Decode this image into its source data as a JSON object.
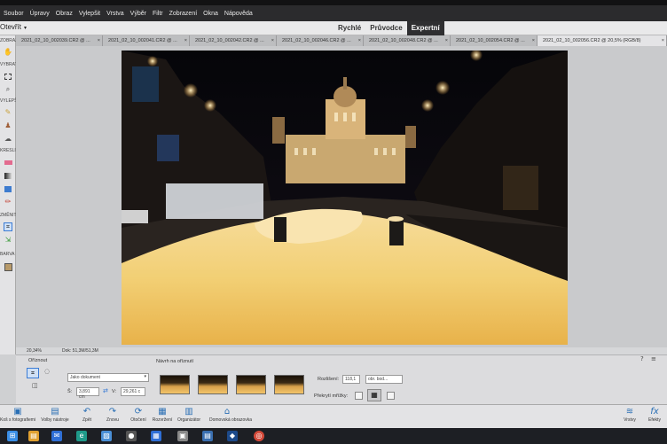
{
  "menu": [
    "Soubor",
    "Úpravy",
    "Obraz",
    "Vylepšit",
    "Vrstva",
    "Výběr",
    "Filtr",
    "Zobrazení",
    "Okna",
    "Nápověda"
  ],
  "modebar": {
    "open_label": "Otevřít",
    "modes": [
      {
        "label": "Rychlé",
        "active": false
      },
      {
        "label": "Průvodce",
        "active": false
      },
      {
        "label": "Expertní",
        "active": true
      }
    ]
  },
  "tabs": [
    "2021_02_10_002039.CR2 @ ...",
    "2021_02_10_002041.CR2 @ ...",
    "2021_02_10_002042.CR2 @ ...",
    "2021_02_10_002046.CR2 @ ...",
    "2021_02_10_002048.CR2 @ ...",
    "2021_02_10_002054.CR2 @ ...",
    "2021_02_10_002056.CR2 @ 20,5% (RGB/8)"
  ],
  "toolbar_sections": [
    "ZOBRAZIT",
    "VYBRAT",
    "VYLEPŠIT",
    "KRESLIT",
    "ZMĚNIT",
    "BARVA"
  ],
  "status": {
    "zoom": "20,34%",
    "doc": "Dok: 51,3M/51,3M"
  },
  "options": {
    "section_label": "Oříznout",
    "preset_value": "Jako dokument",
    "width_label": "Š:",
    "width_value": "3,891 cm",
    "height_label": "V:",
    "height_value": "29,261 c",
    "suggestions_label": "Návrh na oříznutí",
    "resolution_label": "Rozlišení:",
    "resolution_value": "118,1",
    "resolution_unit": "obr. bod...",
    "grid_label": "Překrytí mřížky:"
  },
  "bottom_buttons": [
    {
      "icon": "photo-bin-icon",
      "label": "Koš s fotografiemi"
    },
    {
      "icon": "tool-options-icon",
      "label": "Volby nástroje"
    },
    {
      "icon": "undo-icon",
      "label": "Zpět"
    },
    {
      "icon": "redo-icon",
      "label": "Znovu"
    },
    {
      "icon": "rotate-icon",
      "label": "Otočení"
    },
    {
      "icon": "layout-icon",
      "label": "Rozvržení"
    },
    {
      "icon": "organizer-icon",
      "label": "Organizátor"
    },
    {
      "icon": "home-screen-icon",
      "label": "Domovská obrazovka"
    }
  ],
  "right_buttons": [
    {
      "icon": "layers-icon",
      "label": "Vrstvy"
    },
    {
      "icon": "effects-icon",
      "label": "Efekty"
    }
  ],
  "colors": {
    "menubar": "#2b2b2d",
    "accent": "#2a6fb5",
    "active_mode": "#2f2f31"
  }
}
